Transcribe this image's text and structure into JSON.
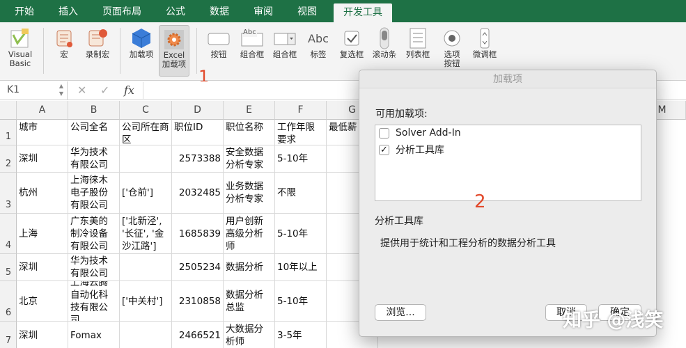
{
  "tabs": [
    "开始",
    "插入",
    "页面布局",
    "公式",
    "数据",
    "审阅",
    "视图",
    "开发工具"
  ],
  "active_tab_index": 7,
  "ribbon": {
    "visual_basic": "Visual\nBasic",
    "macro": "宏",
    "record_macro": "录制宏",
    "addins": "加载项",
    "excel_addins": "Excel\n加载项",
    "button": "按钮",
    "group_box": "组合框",
    "combo_box": "组合框",
    "label": "标签",
    "label_sample": "Abc",
    "group_box_sample": "Abc",
    "checkbox": "复选框",
    "scrollbar": "滚动条",
    "listbox": "列表框",
    "option_button": "选项\n按钮",
    "spinner": "微调框"
  },
  "annotation1": "1",
  "annotation2": "2",
  "formula_bar": {
    "name_box": "K1",
    "cancel": "✕",
    "enter": "✓",
    "fx": "fx",
    "formula": ""
  },
  "columns": [
    "A",
    "B",
    "C",
    "D",
    "E",
    "F",
    "G",
    "M"
  ],
  "row_numbers": [
    "1",
    "2",
    "3",
    "4",
    "5",
    "6",
    "7"
  ],
  "rows": [
    [
      "城市",
      "公司全名",
      "公司所在商区",
      "职位ID",
      "职位名称",
      "工作年限要求",
      "最低薪"
    ],
    [
      "深圳",
      "华为技术有限公司",
      "",
      "2573388",
      "安全数据分析专家",
      "5-10年",
      ""
    ],
    [
      "杭州",
      "上海徕木电子股份有限公司",
      "['仓前']",
      "2032485",
      "业务数据分析专家",
      "不限",
      ""
    ],
    [
      "上海",
      "广东美的制冷设备有限公司",
      "['北新泾', '长征', '金沙江路']",
      "1685839",
      "用户创新高级分析师",
      "5-10年",
      ""
    ],
    [
      "深圳",
      "华为技术有限公司",
      "",
      "2505234",
      "数据分析",
      "10年以上",
      ""
    ],
    [
      "北京",
      "上海云腾自动化科技有限公司",
      "['中关村']",
      "2310858",
      "数据分析总监",
      "5-10年",
      ""
    ],
    [
      "深圳",
      "Fomax",
      "",
      "2466521",
      "大数据分析师",
      "3-5年",
      ""
    ]
  ],
  "dialog": {
    "title": "加载项",
    "available_label": "可用加载项:",
    "items": [
      {
        "label": "Solver Add-In",
        "checked": false
      },
      {
        "label": "分析工具库",
        "checked": true
      }
    ],
    "selected_title": "分析工具库",
    "description": "提供用于统计和工程分析的数据分析工具",
    "browse_button": "浏览...",
    "cancel_button": "取消",
    "ok_button": "确定"
  },
  "watermark": "知乎 @浅笑",
  "colors": {
    "excel_green": "#1e7145",
    "annotation_red": "#e2492b"
  }
}
